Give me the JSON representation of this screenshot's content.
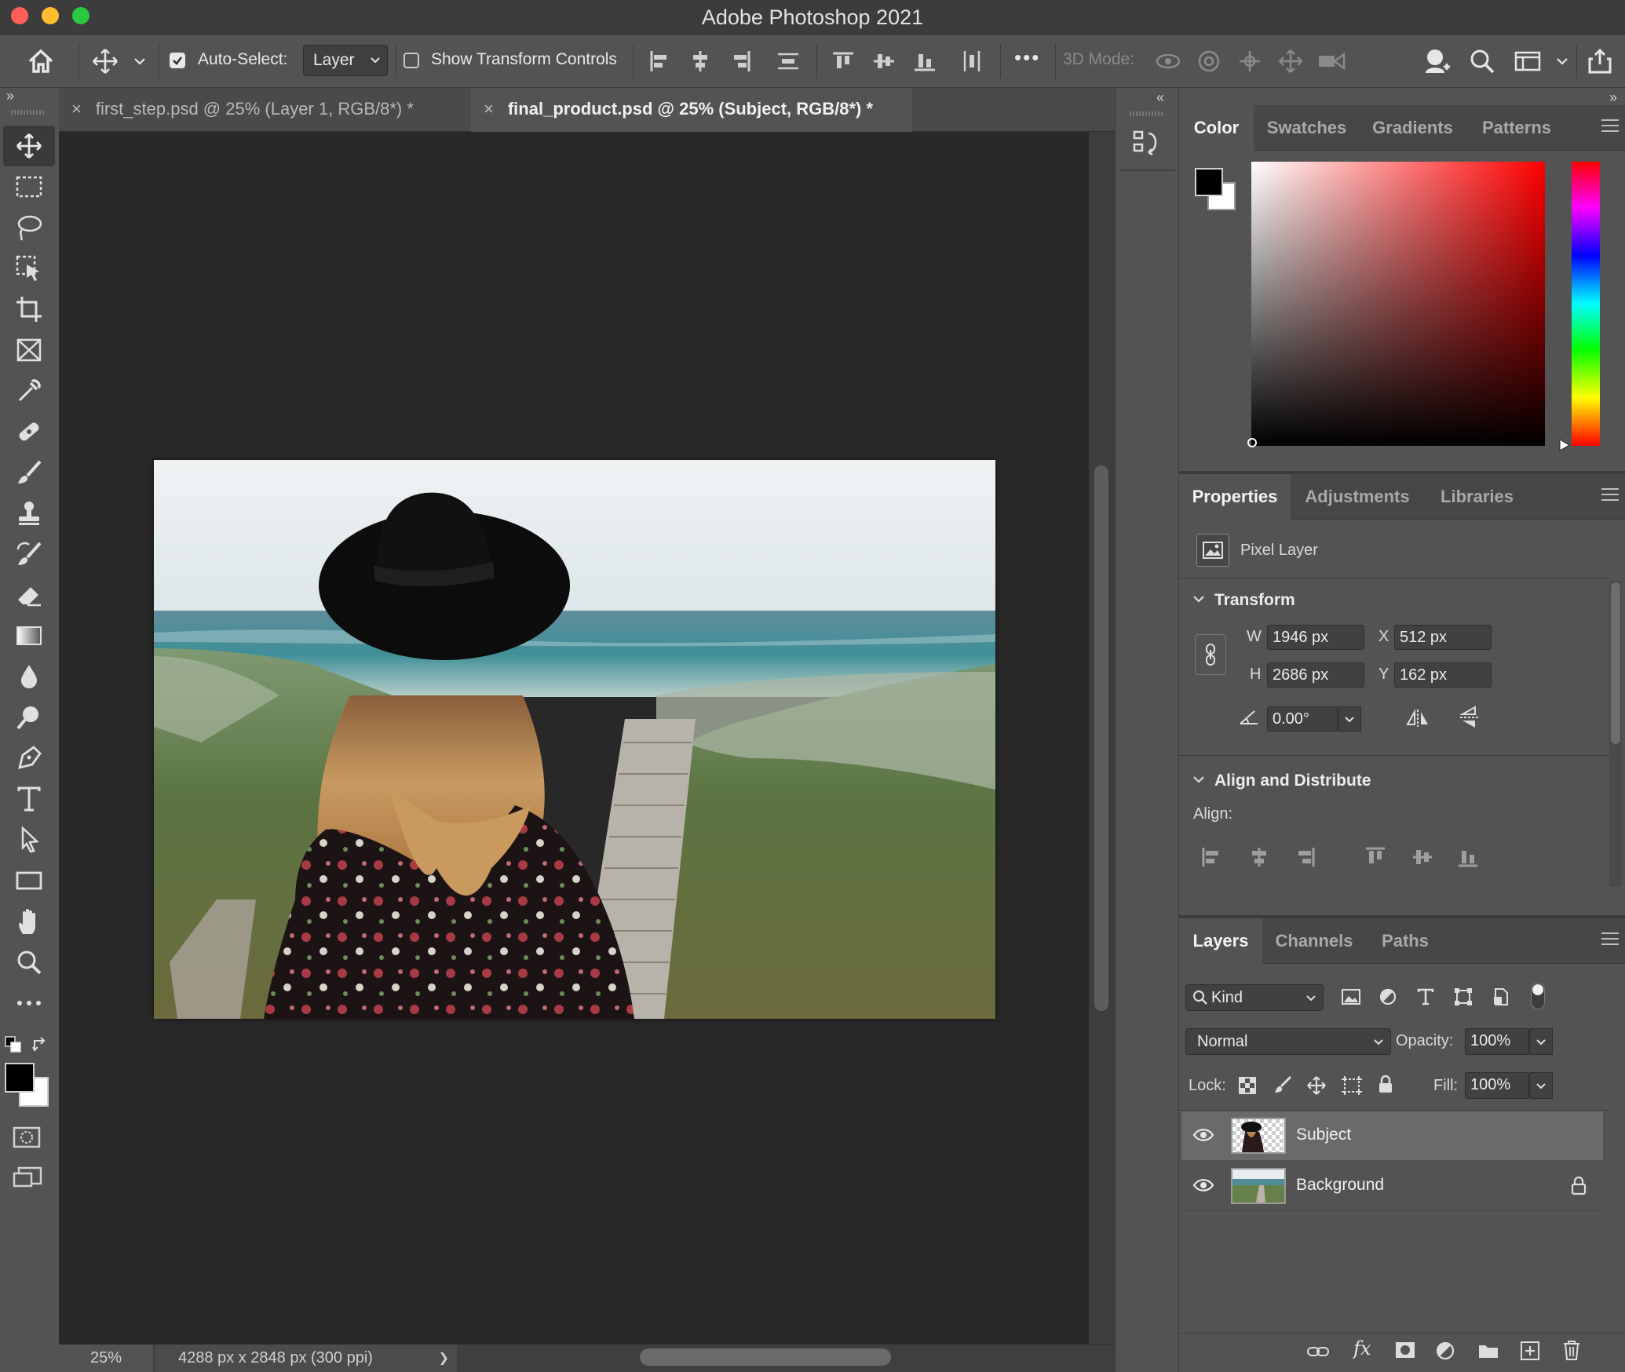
{
  "window": {
    "title": "Adobe Photoshop 2021",
    "traffic_colors": [
      "#fe5f57",
      "#febc2e",
      "#28c840"
    ]
  },
  "options_bar": {
    "auto_select_label": "Auto-Select:",
    "auto_select_checked": true,
    "auto_select_target": "Layer",
    "show_transform_controls_label": "Show Transform Controls",
    "show_transform_controls_checked": false,
    "more_label": "•••",
    "mode_3d_label": "3D Mode:"
  },
  "document_tabs": [
    {
      "label": "first_step.psd @ 25% (Layer 1, RGB/8*) *",
      "active": false,
      "close": "×"
    },
    {
      "label": "final_product.psd @ 25% (Subject, RGB/8*) *",
      "active": true,
      "close": "×"
    }
  ],
  "collapse_glyphs": {
    "left": "»",
    "mid": "«",
    "right": "»"
  },
  "tools": [
    "move-icon",
    "marquee-icon",
    "lasso-icon",
    "object-selection-icon",
    "crop-icon",
    "frame-icon",
    "eyedropper-icon",
    "healing-brush-icon",
    "brush-icon",
    "clone-stamp-icon",
    "history-brush-icon",
    "eraser-icon",
    "gradient-icon",
    "blur-icon",
    "dodge-icon",
    "pen-icon",
    "type-icon",
    "path-selection-icon",
    "rectangle-icon",
    "hand-icon",
    "zoom-icon",
    "more-tools-icon"
  ],
  "status_bar": {
    "zoom": "25%",
    "document_size": "4288 px x 2848 px (300 ppi)",
    "arrow": "❯"
  },
  "color_panel": {
    "tabs": [
      "Color",
      "Swatches",
      "Gradients",
      "Patterns"
    ],
    "active_tab": "Color",
    "foreground_color": "#000000",
    "background_color": "#ffffff",
    "hue_color": "#ff0000"
  },
  "properties_panel": {
    "tabs": [
      "Properties",
      "Adjustments",
      "Libraries"
    ],
    "active_tab": "Properties",
    "layer_kind": "Pixel Layer",
    "transform_title": "Transform",
    "w_label": "W",
    "w_value": "1946 px",
    "h_label": "H",
    "h_value": "2686 px",
    "x_label": "X",
    "x_value": "512 px",
    "y_label": "Y",
    "y_value": "162 px",
    "angle_value": "0.00°",
    "align_title": "Align and Distribute",
    "align_label": "Align:"
  },
  "layers_panel": {
    "tabs": [
      "Layers",
      "Channels",
      "Paths"
    ],
    "active_tab": "Layers",
    "kind_filter": "Kind",
    "blend_mode": "Normal",
    "opacity_label": "Opacity:",
    "opacity_value": "100%",
    "lock_label": "Lock:",
    "fill_label": "Fill:",
    "fill_value": "100%",
    "layers": [
      {
        "name": "Subject",
        "selected": true,
        "visible": true,
        "locked": false
      },
      {
        "name": "Background",
        "selected": false,
        "visible": true,
        "locked": true
      }
    ],
    "footer_fx": "fx"
  }
}
